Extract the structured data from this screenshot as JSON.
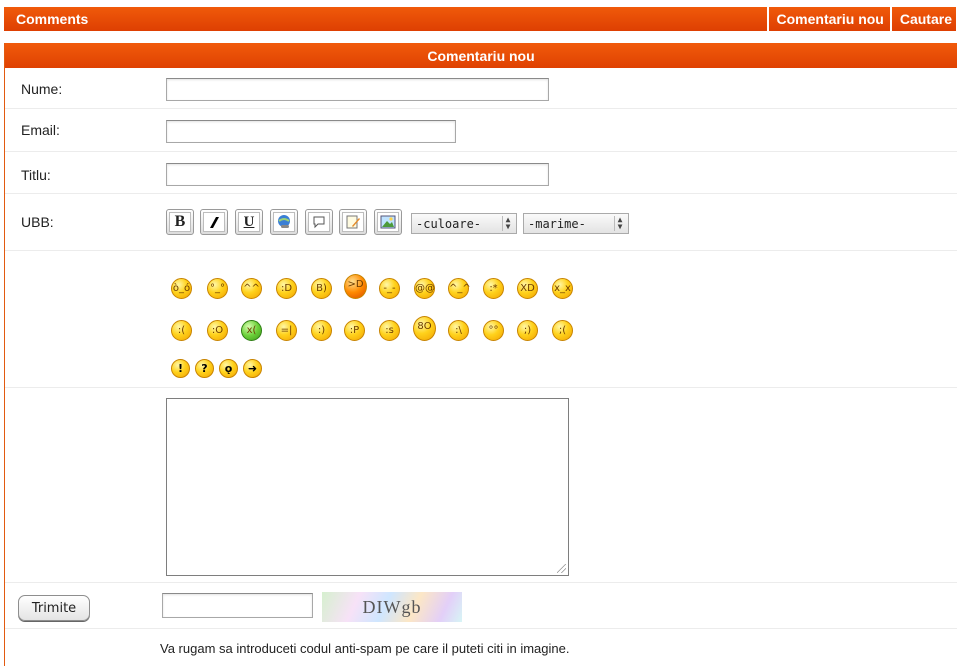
{
  "topbar": {
    "title": "Comments",
    "links": [
      "Comentariu nou",
      "Cautare"
    ]
  },
  "form": {
    "header": "Comentariu nou",
    "name_label": "Nume:",
    "email_label": "Email:",
    "title_label": "Titlu:",
    "ubb_label": "UBB:",
    "ubb_buttons": [
      "B",
      "I",
      "U",
      "link-icon",
      "quote-icon",
      "edit-icon",
      "image-icon"
    ],
    "color_select": "-culoare-",
    "size_select": "-marime-",
    "submit_label": "Trimite",
    "captcha_text": "DIWgb",
    "hint": "Va rugam sa introduceti codul anti-spam pe care il puteti citi in imagine."
  },
  "colors": {
    "accent": "#e4460a",
    "header_text": "#ffffff"
  }
}
